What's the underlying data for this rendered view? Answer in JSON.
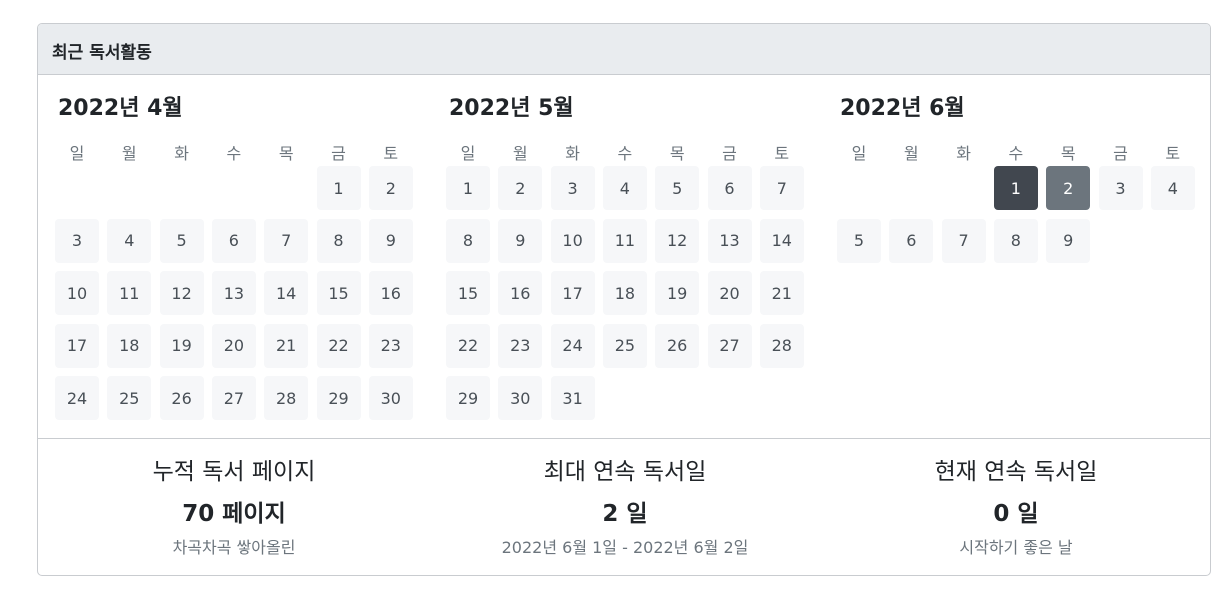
{
  "header": {
    "title": "최근 독서활동"
  },
  "weekdays": [
    "일",
    "월",
    "화",
    "수",
    "목",
    "금",
    "토"
  ],
  "months": [
    {
      "title": "2022년 4월",
      "first_weekday": 5,
      "num_days": 30,
      "activity": {}
    },
    {
      "title": "2022년 5월",
      "first_weekday": 0,
      "num_days": 31,
      "activity": {}
    },
    {
      "title": "2022년 6월",
      "first_weekday": 3,
      "num_days": 9,
      "activity": {
        "1": 2,
        "2": 1
      }
    }
  ],
  "activity_colors": {
    "0": "#f6f7f9",
    "1": "#6c757d",
    "2": "#41474f"
  },
  "stats": [
    {
      "title": "누적 독서 페이지",
      "value": "70 페이지",
      "sub": "차곡차곡 쌓아올린"
    },
    {
      "title": "최대 연속 독서일",
      "value": "2 일",
      "sub": "2022년 6월 1일 - 2022년 6월 2일"
    },
    {
      "title": "현재 연속 독서일",
      "value": "0 일",
      "sub": "시작하기 좋은 날"
    }
  ]
}
